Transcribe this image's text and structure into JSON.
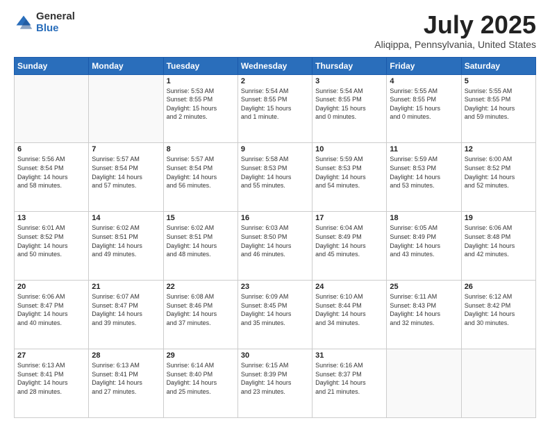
{
  "logo": {
    "general": "General",
    "blue": "Blue"
  },
  "title": {
    "month": "July 2025",
    "location": "Aliqippa, Pennsylvania, United States"
  },
  "headers": [
    "Sunday",
    "Monday",
    "Tuesday",
    "Wednesday",
    "Thursday",
    "Friday",
    "Saturday"
  ],
  "weeks": [
    [
      {
        "day": "",
        "info": ""
      },
      {
        "day": "",
        "info": ""
      },
      {
        "day": "1",
        "info": "Sunrise: 5:53 AM\nSunset: 8:55 PM\nDaylight: 15 hours\nand 2 minutes."
      },
      {
        "day": "2",
        "info": "Sunrise: 5:54 AM\nSunset: 8:55 PM\nDaylight: 15 hours\nand 1 minute."
      },
      {
        "day": "3",
        "info": "Sunrise: 5:54 AM\nSunset: 8:55 PM\nDaylight: 15 hours\nand 0 minutes."
      },
      {
        "day": "4",
        "info": "Sunrise: 5:55 AM\nSunset: 8:55 PM\nDaylight: 15 hours\nand 0 minutes."
      },
      {
        "day": "5",
        "info": "Sunrise: 5:55 AM\nSunset: 8:55 PM\nDaylight: 14 hours\nand 59 minutes."
      }
    ],
    [
      {
        "day": "6",
        "info": "Sunrise: 5:56 AM\nSunset: 8:54 PM\nDaylight: 14 hours\nand 58 minutes."
      },
      {
        "day": "7",
        "info": "Sunrise: 5:57 AM\nSunset: 8:54 PM\nDaylight: 14 hours\nand 57 minutes."
      },
      {
        "day": "8",
        "info": "Sunrise: 5:57 AM\nSunset: 8:54 PM\nDaylight: 14 hours\nand 56 minutes."
      },
      {
        "day": "9",
        "info": "Sunrise: 5:58 AM\nSunset: 8:53 PM\nDaylight: 14 hours\nand 55 minutes."
      },
      {
        "day": "10",
        "info": "Sunrise: 5:59 AM\nSunset: 8:53 PM\nDaylight: 14 hours\nand 54 minutes."
      },
      {
        "day": "11",
        "info": "Sunrise: 5:59 AM\nSunset: 8:53 PM\nDaylight: 14 hours\nand 53 minutes."
      },
      {
        "day": "12",
        "info": "Sunrise: 6:00 AM\nSunset: 8:52 PM\nDaylight: 14 hours\nand 52 minutes."
      }
    ],
    [
      {
        "day": "13",
        "info": "Sunrise: 6:01 AM\nSunset: 8:52 PM\nDaylight: 14 hours\nand 50 minutes."
      },
      {
        "day": "14",
        "info": "Sunrise: 6:02 AM\nSunset: 8:51 PM\nDaylight: 14 hours\nand 49 minutes."
      },
      {
        "day": "15",
        "info": "Sunrise: 6:02 AM\nSunset: 8:51 PM\nDaylight: 14 hours\nand 48 minutes."
      },
      {
        "day": "16",
        "info": "Sunrise: 6:03 AM\nSunset: 8:50 PM\nDaylight: 14 hours\nand 46 minutes."
      },
      {
        "day": "17",
        "info": "Sunrise: 6:04 AM\nSunset: 8:49 PM\nDaylight: 14 hours\nand 45 minutes."
      },
      {
        "day": "18",
        "info": "Sunrise: 6:05 AM\nSunset: 8:49 PM\nDaylight: 14 hours\nand 43 minutes."
      },
      {
        "day": "19",
        "info": "Sunrise: 6:06 AM\nSunset: 8:48 PM\nDaylight: 14 hours\nand 42 minutes."
      }
    ],
    [
      {
        "day": "20",
        "info": "Sunrise: 6:06 AM\nSunset: 8:47 PM\nDaylight: 14 hours\nand 40 minutes."
      },
      {
        "day": "21",
        "info": "Sunrise: 6:07 AM\nSunset: 8:47 PM\nDaylight: 14 hours\nand 39 minutes."
      },
      {
        "day": "22",
        "info": "Sunrise: 6:08 AM\nSunset: 8:46 PM\nDaylight: 14 hours\nand 37 minutes."
      },
      {
        "day": "23",
        "info": "Sunrise: 6:09 AM\nSunset: 8:45 PM\nDaylight: 14 hours\nand 35 minutes."
      },
      {
        "day": "24",
        "info": "Sunrise: 6:10 AM\nSunset: 8:44 PM\nDaylight: 14 hours\nand 34 minutes."
      },
      {
        "day": "25",
        "info": "Sunrise: 6:11 AM\nSunset: 8:43 PM\nDaylight: 14 hours\nand 32 minutes."
      },
      {
        "day": "26",
        "info": "Sunrise: 6:12 AM\nSunset: 8:42 PM\nDaylight: 14 hours\nand 30 minutes."
      }
    ],
    [
      {
        "day": "27",
        "info": "Sunrise: 6:13 AM\nSunset: 8:41 PM\nDaylight: 14 hours\nand 28 minutes."
      },
      {
        "day": "28",
        "info": "Sunrise: 6:13 AM\nSunset: 8:41 PM\nDaylight: 14 hours\nand 27 minutes."
      },
      {
        "day": "29",
        "info": "Sunrise: 6:14 AM\nSunset: 8:40 PM\nDaylight: 14 hours\nand 25 minutes."
      },
      {
        "day": "30",
        "info": "Sunrise: 6:15 AM\nSunset: 8:39 PM\nDaylight: 14 hours\nand 23 minutes."
      },
      {
        "day": "31",
        "info": "Sunrise: 6:16 AM\nSunset: 8:37 PM\nDaylight: 14 hours\nand 21 minutes."
      },
      {
        "day": "",
        "info": ""
      },
      {
        "day": "",
        "info": ""
      }
    ]
  ]
}
